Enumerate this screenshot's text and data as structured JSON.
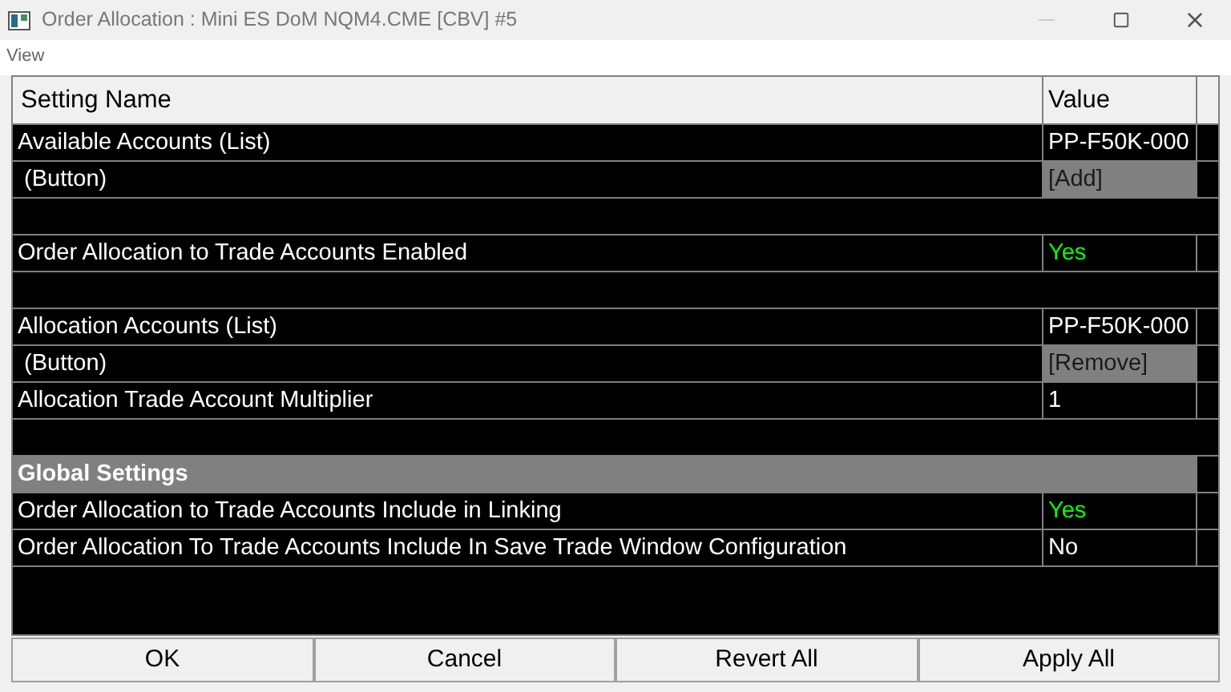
{
  "window": {
    "title": "Order Allocation : Mini ES DoM NQM4.CME [CBV] #5"
  },
  "menu": [
    "View"
  ],
  "table": {
    "columns": [
      "Setting Name",
      "Value"
    ],
    "rows": [
      {
        "kind": "setting",
        "name": "Available Accounts (List)",
        "value": "PP-F50K-000",
        "highlighted": false
      },
      {
        "kind": "button",
        "name": " (Button)",
        "value": "[Add]"
      },
      {
        "kind": "blank"
      },
      {
        "kind": "setting",
        "name": "Order Allocation to Trade Accounts Enabled",
        "value": "Yes",
        "highlighted": true
      },
      {
        "kind": "blank"
      },
      {
        "kind": "setting",
        "name": "Allocation Accounts (List)",
        "value": "PP-F50K-000",
        "highlighted": false
      },
      {
        "kind": "button",
        "name": " (Button)",
        "value": "[Remove]"
      },
      {
        "kind": "setting",
        "name": "Allocation Trade Account Multiplier",
        "value": "1",
        "highlighted": false
      },
      {
        "kind": "blank"
      },
      {
        "kind": "section",
        "name": "Global Settings"
      },
      {
        "kind": "setting",
        "name": "Order Allocation to Trade Accounts Include in Linking",
        "value": "Yes",
        "highlighted": true
      },
      {
        "kind": "setting",
        "name": "Order Allocation To Trade Accounts Include In Save Trade Window Configuration",
        "value": "No",
        "highlighted": false
      }
    ]
  },
  "buttons": [
    "OK",
    "Cancel",
    "Revert All",
    "Apply All"
  ]
}
